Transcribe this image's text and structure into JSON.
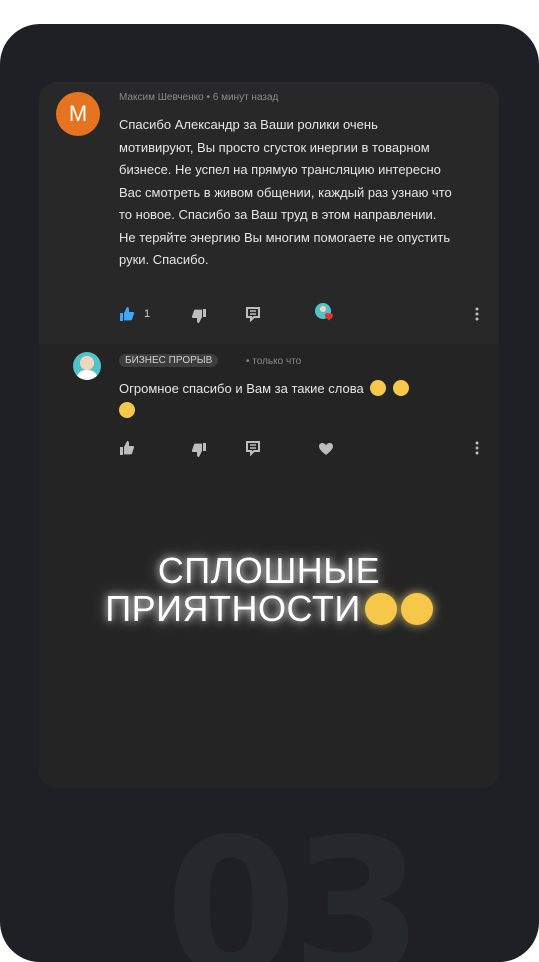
{
  "comment1": {
    "avatar_letter": "M",
    "author": "Максим Шевченко",
    "separator": "•",
    "time": "6 минут назад",
    "text": "Спасибо Александр за Ваши ролики очень мотивируют, Вы просто сгусток инергии в товарном бизнесе. Не успел на прямую трансляцию интересно Вас смотреть в живом общении, каждый раз узнаю что то новое. Спасибо за Ваш труд в этом направлении. Не теряйте энергию Вы многим помогаете не опустить руки. Спасибо.",
    "likes": "1"
  },
  "comment2": {
    "author": "БИЗНЕС ПРОРЫВ",
    "time": "• только что",
    "text": "Огромное спасибо и Вам за такие слова"
  },
  "headline": {
    "line1": "СПЛОШНЫЕ",
    "line2": "ПРИЯТНОСТИ"
  },
  "page_number": "03",
  "colors": {
    "background": "#1e2025",
    "card": "#262626",
    "avatar_m": "#e6731f",
    "like_active": "#3ea6ff",
    "emoji": "#f5c84a"
  },
  "icons": [
    "thumbs-up-icon",
    "thumbs-down-icon",
    "reply-icon",
    "heart-icon",
    "more-icon"
  ]
}
